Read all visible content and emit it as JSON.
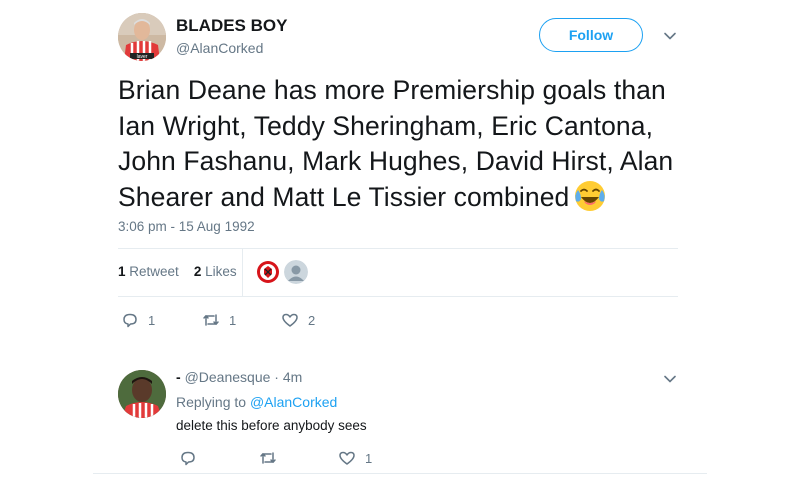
{
  "tweet": {
    "author_name": "BLADES BOY",
    "author_handle": "@AlanCorked",
    "follow_label": "Follow",
    "text": "Brian Deane has more Premiership goals than Ian Wright, Teddy Sheringham, Eric Cantona, John Fashanu, Mark Hughes, David Hirst, Alan Shearer and Matt Le Tissier combined",
    "emoji_icon": "face-with-tears-of-joy-icon",
    "timestamp": "3:06 pm - 15 Aug 1992",
    "retweet_count": "1",
    "retweet_label": "Retweet",
    "likes_count": "2",
    "likes_label": "Likes",
    "actions": {
      "reply_count": "1",
      "retweet_count": "1",
      "like_count": "2"
    }
  },
  "reply": {
    "dash": "-",
    "handle": "@Deanesque",
    "separator_time": "· 4m",
    "replying_prefix": "Replying to",
    "replying_to": "@AlanCorked",
    "text": "delete this before anybody sees",
    "actions": {
      "reply_count": "",
      "retweet_count": "",
      "like_count": "1"
    }
  },
  "colors": {
    "accent": "#1da1f2",
    "secondary_text": "#657786",
    "divider": "#e6ecf0"
  }
}
